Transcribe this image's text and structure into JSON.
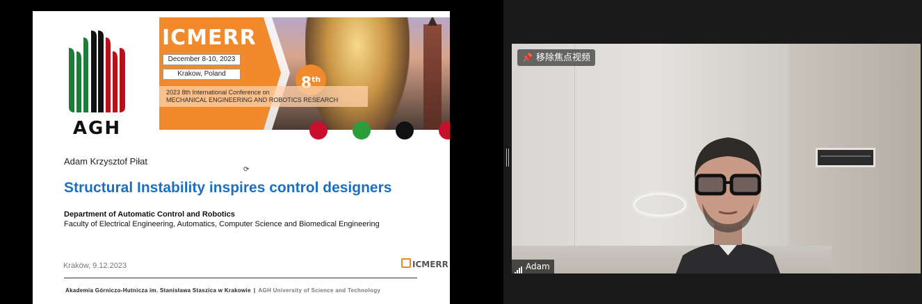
{
  "slide": {
    "logo_text": "AGH",
    "banner": {
      "conference_name": "ICMERR",
      "dates": "December 8-10, 2023",
      "location": "Krakow, Poland",
      "edition_number": "8",
      "edition_suffix": "th",
      "conference_line1": "2023 8th International Conference on",
      "conference_line2": "MECHANICAL ENGINEERING AND ROBOTICS RESEARCH"
    },
    "author": "Adam Krzysztof Piłat",
    "title": "Structural Instability inspires control designers",
    "department": "Department of Automatic Control and Robotics",
    "faculty": "Faculty of Electrical Engineering, Automatics,  Computer Science and Biomedical Engineering",
    "date_place": "Kraków, 9.12.2023",
    "small_logo_text": "ICMERR",
    "footer_pl": "Akademia Górniczo-Hutnicza im. Stanisława Staszica w Krakowie",
    "footer_sep": "|",
    "footer_en": "AGH University of Science and Technology"
  },
  "video": {
    "unpin_label": "移除焦点视频",
    "participant_name": "Adam"
  },
  "colors": {
    "title_blue": "#1c6fc0",
    "banner_orange": "#f08a2c",
    "agh_green": "#1f7a3a",
    "agh_red": "#b5121b",
    "dot_colors": [
      "#c8102e",
      "#2a9d3a",
      "#111111",
      "#c8102e"
    ]
  },
  "icons": {
    "pin": "pin-icon",
    "signal": "signal-bars-icon"
  }
}
